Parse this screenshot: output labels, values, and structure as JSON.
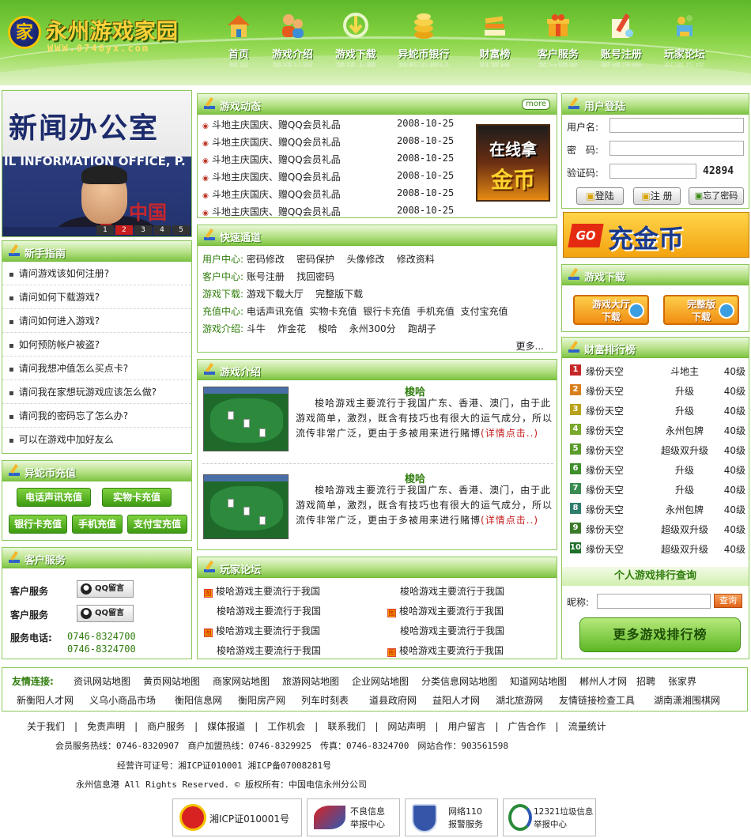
{
  "site": {
    "logo_text": "永州游戏家园",
    "logo_url": "WWW.0746yx.com",
    "emblem": "家"
  },
  "nav": [
    {
      "label": "首页",
      "icon": "house-icon"
    },
    {
      "label": "游戏介绍",
      "icon": "people-icon"
    },
    {
      "label": "游戏下载",
      "icon": "download-icon"
    },
    {
      "label": "异蛇币银行",
      "icon": "coins-icon"
    },
    {
      "label": "财富榜",
      "icon": "books-icon"
    },
    {
      "label": "客户服务",
      "icon": "gift-icon"
    },
    {
      "label": "账号注册",
      "icon": "pen-icon"
    },
    {
      "label": "玩家论坛",
      "icon": "trophy-icon"
    }
  ],
  "photo": {
    "caption_big": "新闻办公室",
    "caption_small": "IL INFORMATION OFFICE, P.",
    "mark": "中国",
    "pages": [
      "1",
      "2",
      "3",
      "4",
      "5"
    ],
    "active_page": "2"
  },
  "guide": {
    "title": "新手指南",
    "items": [
      "请问游戏该如何注册?",
      "请问如何下载游戏?",
      "请问如何进入游戏?",
      "如何预防帐户被盗?",
      "请问我想冲值怎么买点卡?",
      "请问我在家想玩游戏应该怎么做?",
      "请问我的密码忘了怎么办?",
      "可以在游戏中加好友么"
    ]
  },
  "recharge": {
    "title": "异蛇币充值",
    "buttons": [
      "电话声讯充值",
      "实物卡充值",
      "银行卡充值",
      "手机充值",
      "支付宝充值"
    ]
  },
  "service": {
    "title": "客户服务",
    "rows": [
      {
        "label": "客户服务",
        "btn": "QQ留言"
      },
      {
        "label": "客户服务",
        "btn": "QQ留言"
      }
    ],
    "phone_label": "服务电话:",
    "phones": [
      "0746-8324700",
      "0746-8324700"
    ]
  },
  "news": {
    "title": "游戏动态",
    "more": "more",
    "items": [
      {
        "text": "斗地主庆国庆、赠QQ会员礼品",
        "date": "2008-10-25"
      },
      {
        "text": "斗地主庆国庆、赠QQ会员礼品",
        "date": "2008-10-25"
      },
      {
        "text": "斗地主庆国庆、赠QQ会员礼品",
        "date": "2008-10-25"
      },
      {
        "text": "斗地主庆国庆、赠QQ会员礼品",
        "date": "2008-10-25"
      },
      {
        "text": "斗地主庆国庆、赠QQ会员礼品",
        "date": "2008-10-25"
      },
      {
        "text": "斗地主庆国庆、赠QQ会员礼品",
        "date": "2008-10-25"
      }
    ],
    "ad_line1": "在线拿",
    "ad_line2": "金币"
  },
  "quick": {
    "title": "快速通道",
    "rows": [
      {
        "label": "用户中心:",
        "links": [
          "密码修改",
          "密码保护",
          "头像修改",
          "修改资料"
        ]
      },
      {
        "label": "客户中心:",
        "links": [
          "账号注册",
          "找回密码"
        ]
      },
      {
        "label": "游戏下载:",
        "links": [
          "游戏下载大厅",
          "完整版下载"
        ]
      },
      {
        "label": "充值中心:",
        "links": [
          "电话声讯充值",
          "实物卡充值",
          "银行卡充值",
          "手机充值",
          "支付宝充值"
        ]
      },
      {
        "label": "游戏介绍:",
        "links": [
          "斗牛",
          "炸金花",
          "梭哈",
          "永州300分",
          "跑胡子"
        ]
      }
    ],
    "more": "更多..."
  },
  "intro": {
    "title": "游戏介绍",
    "games": [
      {
        "name": "梭哈",
        "desc": "梭哈游戏主要流行于我国广东、香港、澳门，由于此游戏简单，激烈，既含有技巧也有很大的运气成分，所以流传非常广泛，更由于多被用来进行赌博",
        "link": "(详情点击..)"
      },
      {
        "name": "梭哈",
        "desc": "梭哈游戏主要流行于我国广东、香港、澳门，由于此游戏简单，激烈，既含有技巧也有很大的运气成分，所以流传非常广泛，更由于多被用来进行赌博",
        "link": "(详情点击..)"
      }
    ]
  },
  "forum": {
    "title": "玩家论坛",
    "posts": [
      {
        "text": "梭哈游戏主要流行于我国",
        "tag": true
      },
      {
        "text": "梭哈游戏主要流行于我国",
        "tag": false
      },
      {
        "text": "梭哈游戏主要流行于我国",
        "tag": false
      },
      {
        "text": "梭哈游戏主要流行于我国",
        "tag": true
      },
      {
        "text": "梭哈游戏主要流行于我国",
        "tag": true
      },
      {
        "text": "梭哈游戏主要流行于我国",
        "tag": false
      },
      {
        "text": "梭哈游戏主要流行于我国",
        "tag": false
      },
      {
        "text": "梭哈游戏主要流行于我国",
        "tag": true
      }
    ]
  },
  "login": {
    "title": "用户登陆",
    "username_label": "用户名:",
    "password_label": "密　码:",
    "captcha_label": "验证码:",
    "captcha": "42894",
    "btn_login": "登陆",
    "btn_register": "注 册",
    "btn_forgot": "忘了密码"
  },
  "banner": {
    "go": "GO",
    "text": "充金币"
  },
  "download": {
    "title": "游戏下载",
    "btn1_line1": "游戏大厅",
    "btn1_line2": "下载",
    "btn2_line1": "完整版",
    "btn2_line2": "下载"
  },
  "ranking": {
    "title": "财富排行榜",
    "rows": [
      {
        "n": "1",
        "user": "缘份天空",
        "game": "斗地主",
        "level": "40级"
      },
      {
        "n": "2",
        "user": "缘份天空",
        "game": "升级",
        "level": "40级"
      },
      {
        "n": "3",
        "user": "缘份天空",
        "game": "升级",
        "level": "40级"
      },
      {
        "n": "4",
        "user": "缘份天空",
        "game": "永州包牌",
        "level": "40级"
      },
      {
        "n": "5",
        "user": "缘份天空",
        "game": "超级双升级",
        "level": "40级"
      },
      {
        "n": "6",
        "user": "缘份天空",
        "game": "升级",
        "level": "40级"
      },
      {
        "n": "7",
        "user": "缘份天空",
        "game": "升级",
        "level": "40级"
      },
      {
        "n": "8",
        "user": "缘份天空",
        "game": "永州包牌",
        "level": "40级"
      },
      {
        "n": "9",
        "user": "缘份天空",
        "game": "超级双升级",
        "level": "40级"
      },
      {
        "n": "10",
        "user": "缘份天空",
        "game": "超级双升级",
        "level": "40级"
      }
    ],
    "query_title": "个人游戏排行查询",
    "nick_label": "昵称:",
    "query_btn": "查询",
    "more_btn": "更多游戏排行榜"
  },
  "friend_links": {
    "label": "友情连接:",
    "row1": [
      "资讯网站地图",
      "黄页网站地图",
      "商家网站地图",
      "旅游网站地图",
      "企业网站地图",
      "分类信息网站地图",
      "知道网站地图",
      "郴州人才网",
      "招聘",
      "张家界"
    ],
    "row2": [
      "新衡阳人才网",
      "义乌小商品市场",
      "衡阳信息网",
      "衡阳房产网",
      "列车时刻表",
      "道县政府网",
      "益阳人才网",
      "湖北旅游网",
      "友情链接检查工具",
      "湖南潇湘围棋网"
    ]
  },
  "footer": {
    "links": [
      "关于我们",
      "免责声明",
      "商户服务",
      "媒体报道",
      "工作机会",
      "联系我们",
      "网站声明",
      "用户留言",
      "广告合作",
      "流量统计"
    ],
    "line2": "会员服务热线：0746-8320907　商户加盟热线：0746-8329925　传真：0746-8324700　网站合作：903561598",
    "line3": "经营许可证号：湘ICP证010001 湘ICP备07008281号",
    "line4": "永州信息港 All Rights Reserved. © 版权所有：中国电信永州分公司",
    "badges": [
      "湘ICP证010001号",
      "不良信息|举报中心",
      "网络110|报警服务",
      "12321垃圾信息|举报中心"
    ]
  },
  "colors": {
    "brand_green": "#5fb82a",
    "title_text": "#ffffff",
    "accent_red": "#c51d1d",
    "link_green": "#2f7d0d"
  }
}
